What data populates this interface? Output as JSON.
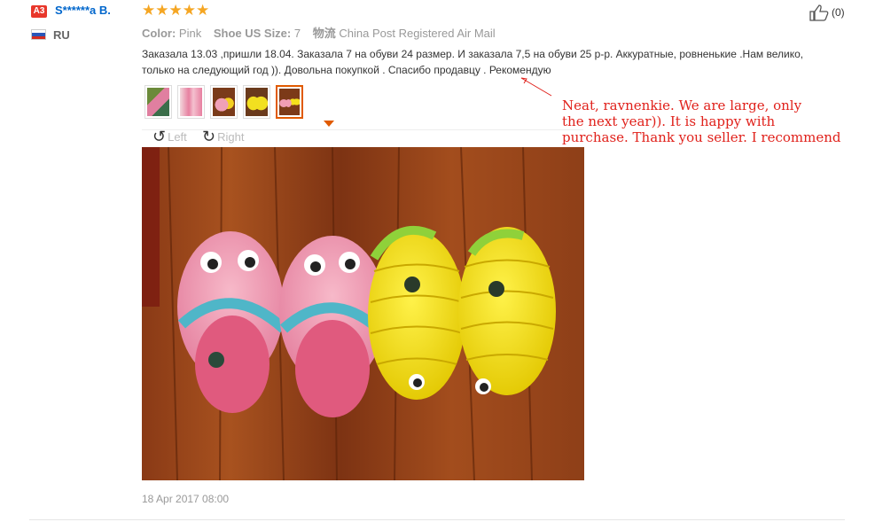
{
  "reviewer": {
    "level_badge": "A3",
    "name": "S******a B.",
    "country": "RU",
    "rating_stars": 5
  },
  "helpful": {
    "count": "(0)"
  },
  "attributes": [
    {
      "key": "Color:",
      "value": "Pink"
    },
    {
      "key": "Shoe US Size:",
      "value": "7"
    },
    {
      "key": "物流",
      "value": "China Post Registered Air Mail"
    }
  ],
  "review_text": "Заказала 13.03 ,пришли 18.04. Заказала 7 на обуви 24 размер. И заказала 7,5 на обуви 25 р-р. Аккуратные, ровненькие .Нам велико, только на следующий год )). Довольна покупкой . Спасибо продавцу . Рекомендую",
  "annotation": "Neat, ravnenkie. We are large, only\nthe next year)). It is happy with\npurchase. Thank you seller. I recommend",
  "image_tools": {
    "left_label": "Left",
    "right_label": "Right"
  },
  "thumbnails_selected_index": 4,
  "date": "18 Apr 2017 08:00",
  "colors": {
    "badge": "#e8372b",
    "name": "#0066cc",
    "star": "#f5a623",
    "selected": "#e05a00",
    "annotation": "#e0211b"
  }
}
